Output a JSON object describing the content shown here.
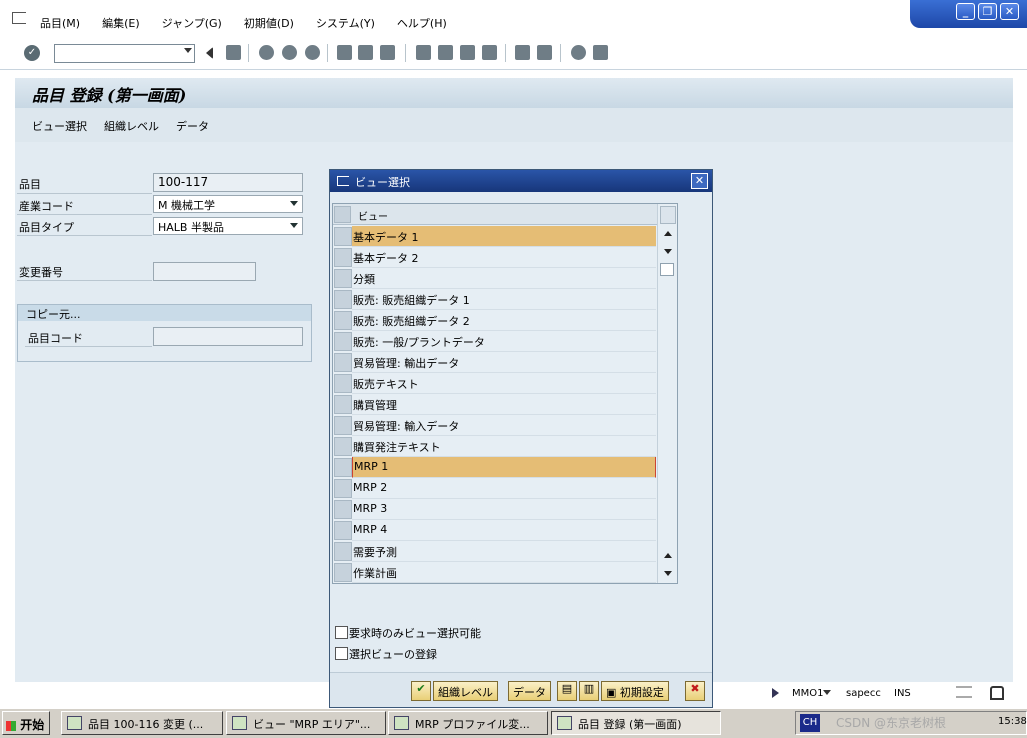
{
  "menubar": {
    "items": [
      "品目(M)",
      "編集(E)",
      "ジャンプ(G)",
      "初期値(D)",
      "システム(Y)",
      "ヘルプ(H)"
    ]
  },
  "window_controls": {
    "minimize": "_",
    "restore": "❐",
    "close": "✕"
  },
  "toolbar": {
    "command_field_value": ""
  },
  "screen": {
    "title": "品目 登録 (第一画面)",
    "app_toolbar": [
      "ビュー選択",
      "組織レベル",
      "データ"
    ]
  },
  "form": {
    "material_label": "品目",
    "material_value": "100-117",
    "industry_label": "産業コード",
    "industry_value": "M 機械工学",
    "type_label": "品目タイプ",
    "type_value": "HALB 半製品",
    "change_no_label": "変更番号",
    "change_no_value": "",
    "copy_group_title": "コピー元...",
    "copy_material_label": "品目コード",
    "copy_material_value": ""
  },
  "dialog": {
    "title": "ビュー選択",
    "column_header": "ビュー",
    "rows": [
      {
        "label": "基本データ 1",
        "selected": true
      },
      {
        "label": "基本データ 2",
        "selected": false
      },
      {
        "label": "分類",
        "selected": false
      },
      {
        "label": "販売: 販売組織データ 1",
        "selected": false
      },
      {
        "label": "販売: 販売組織データ 2",
        "selected": false
      },
      {
        "label": "販売: 一般/プラントデータ",
        "selected": false
      },
      {
        "label": "貿易管理: 輸出データ",
        "selected": false
      },
      {
        "label": "販売テキスト",
        "selected": false
      },
      {
        "label": "購買管理",
        "selected": false
      },
      {
        "label": "貿易管理: 輸入データ",
        "selected": false
      },
      {
        "label": "購買発注テキスト",
        "selected": false
      },
      {
        "label": "MRP 1",
        "selected": true
      },
      {
        "label": "MRP 2",
        "selected": false
      },
      {
        "label": "MRP 3",
        "selected": false
      },
      {
        "label": "MRP 4",
        "selected": false
      },
      {
        "label": "需要予測",
        "selected": false
      },
      {
        "label": "作業計画",
        "selected": false
      }
    ],
    "checkbox1_label": "要求時のみビュー選択可能",
    "checkbox2_label": "選択ビューの登録",
    "buttons": {
      "org_level": "組織レベル",
      "data": "データ",
      "defaults": "初期設定"
    },
    "highlight_color": "#e5bd75"
  },
  "statusbar": {
    "system": "MMO1",
    "server": "sapecc",
    "mode": "INS"
  },
  "taskbar": {
    "start": "开始",
    "tasks": [
      "品目 100-116 変更 (...",
      "ビュー \"MRP エリア\"...",
      "MRP プロファイル変...",
      "品目 登録 (第一画面)"
    ],
    "ime": "CH",
    "clock": "15:38",
    "watermark": "CSDN @东京老树根"
  }
}
